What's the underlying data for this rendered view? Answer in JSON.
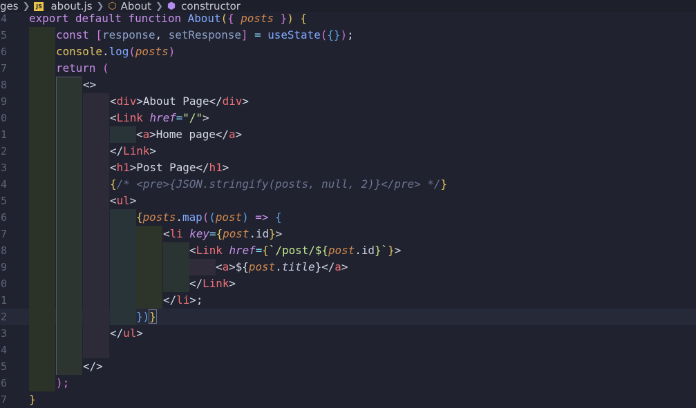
{
  "breadcrumb": {
    "folder": "ges",
    "file": "about.js",
    "file_badge": "JS",
    "symbol": "About",
    "member": "constructor"
  },
  "line_numbers": [
    "4",
    "5",
    "6",
    "7",
    "8",
    "9",
    "0",
    "1",
    "2",
    "3",
    "4",
    "5",
    "6",
    "7",
    "8",
    "9",
    "0",
    "1",
    "2",
    "3",
    "4",
    "5",
    "6",
    "7"
  ],
  "code": {
    "l4": [
      "export",
      " ",
      "default",
      " ",
      "function",
      " ",
      "About",
      "(",
      "{ ",
      "posts",
      " }",
      ")",
      " {"
    ],
    "l5": [
      "const",
      " ",
      "[",
      "response",
      ", ",
      "setResponse",
      "]",
      " = ",
      "useState",
      "(",
      "{}",
      ")",
      ";"
    ],
    "l6": [
      "console",
      ".",
      "log",
      "(",
      "posts",
      ")"
    ],
    "l7": [
      "return",
      " ",
      "("
    ],
    "l8": [
      "<>"
    ],
    "l9": [
      "<",
      "div",
      ">About Page</",
      "div",
      ">"
    ],
    "l10": [
      "<",
      "Link",
      " ",
      "href",
      "=",
      "\"/\"",
      ">"
    ],
    "l11": [
      "<",
      "a",
      ">Home page</",
      "a",
      ">"
    ],
    "l12": [
      "</",
      "Link",
      ">"
    ],
    "l13": [
      "<",
      "h1",
      ">Post Page</",
      "h1",
      ">"
    ],
    "l14": [
      "{",
      "/* <pre>{JSON.stringify(posts, null, 2)}</pre> */",
      "}"
    ],
    "l15": [
      "<",
      "ul",
      ">"
    ],
    "l16": [
      "{",
      "posts",
      ".",
      "map",
      "(",
      "(",
      "post",
      ")",
      " => ",
      "{"
    ],
    "l17": [
      "<",
      "li",
      " ",
      "key",
      "=",
      "{",
      "post",
      ".",
      "id",
      "}",
      ">"
    ],
    "l18": [
      "<",
      "Link",
      " ",
      "href",
      "=",
      "{",
      "`/post/${",
      "post",
      ".",
      "id",
      "}`",
      "}",
      ">"
    ],
    "l19": [
      "<",
      "a",
      ">",
      "${",
      "post",
      ".",
      "title",
      "}",
      "</",
      "a",
      ">"
    ],
    "l20": [
      "</",
      "Link",
      ">"
    ],
    "l21": [
      "</",
      "li",
      ">;"
    ],
    "l22": [
      "})",
      "}"
    ],
    "l23": [
      "</",
      "ul",
      ">"
    ],
    "l25": [
      "</>"
    ],
    "l26": [
      ");"
    ],
    "l27": [
      "}"
    ]
  },
  "colors": {
    "background": "#202230",
    "keyword": "#c792ea",
    "function": "#82aaff",
    "tag": "#f07178",
    "string": "#c3e88d",
    "comment": "#6e7491",
    "parameter": "#d38a4f"
  }
}
